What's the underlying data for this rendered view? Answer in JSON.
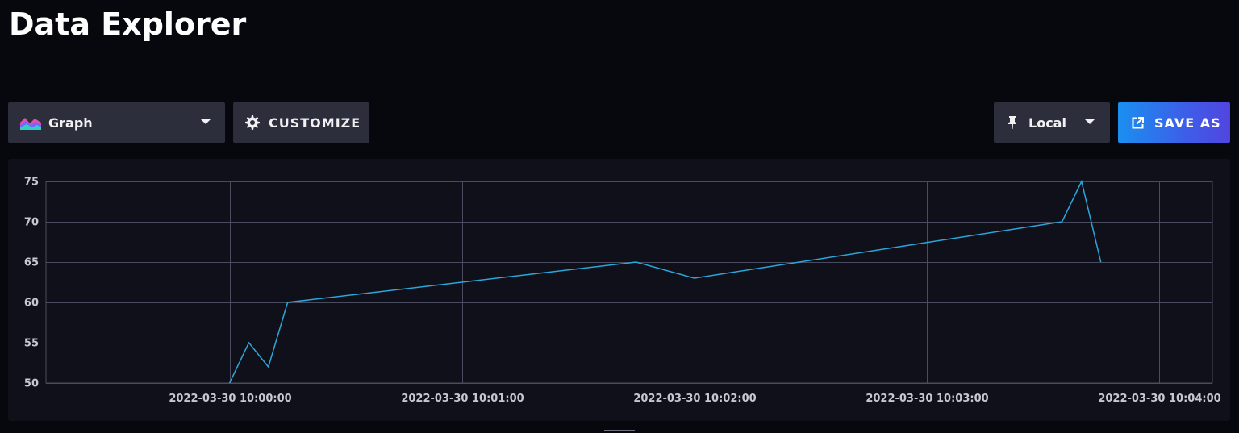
{
  "header": {
    "title": "Data Explorer"
  },
  "toolbar": {
    "visualization_label": "Graph",
    "customize_label": "CUSTOMIZE",
    "timezone_label": "Local",
    "save_as_label": "SAVE AS"
  },
  "icons": {
    "graph": "graph-type-icon",
    "customize": "gear-icon",
    "timezone": "pin-icon",
    "save_as": "external-link-icon",
    "dropdown": "caret-down-icon"
  },
  "colors": {
    "background": "#07080d",
    "panel": "#0f101a",
    "button": "#2c2e3c",
    "line": "#2aa7db",
    "grid": "#4a4b5e",
    "save_gradient_start": "#1a8ff0",
    "save_gradient_end": "#5145e0"
  },
  "chart_data": {
    "type": "line",
    "y_ticks": [
      "75",
      "70",
      "65",
      "60",
      "55",
      "50"
    ],
    "ylim": [
      50,
      75
    ],
    "x_ticks": [
      "2022-03-30 10:00:00",
      "2022-03-30 10:01:00",
      "2022-03-30 10:02:00",
      "2022-03-30 10:03:00",
      "2022-03-30 10:04:00"
    ],
    "x_tick_minutes": [
      0,
      1,
      2,
      3,
      4
    ],
    "xlim_minutes": [
      -0.79,
      4.23
    ],
    "grid": true,
    "series": [
      {
        "x_minutes": [
          0.0,
          0.083,
          0.167,
          0.25,
          1.75,
          2.0,
          3.583,
          3.667,
          3.75
        ],
        "values": [
          50,
          55,
          52,
          60,
          65,
          63,
          70,
          75,
          65
        ]
      }
    ]
  }
}
